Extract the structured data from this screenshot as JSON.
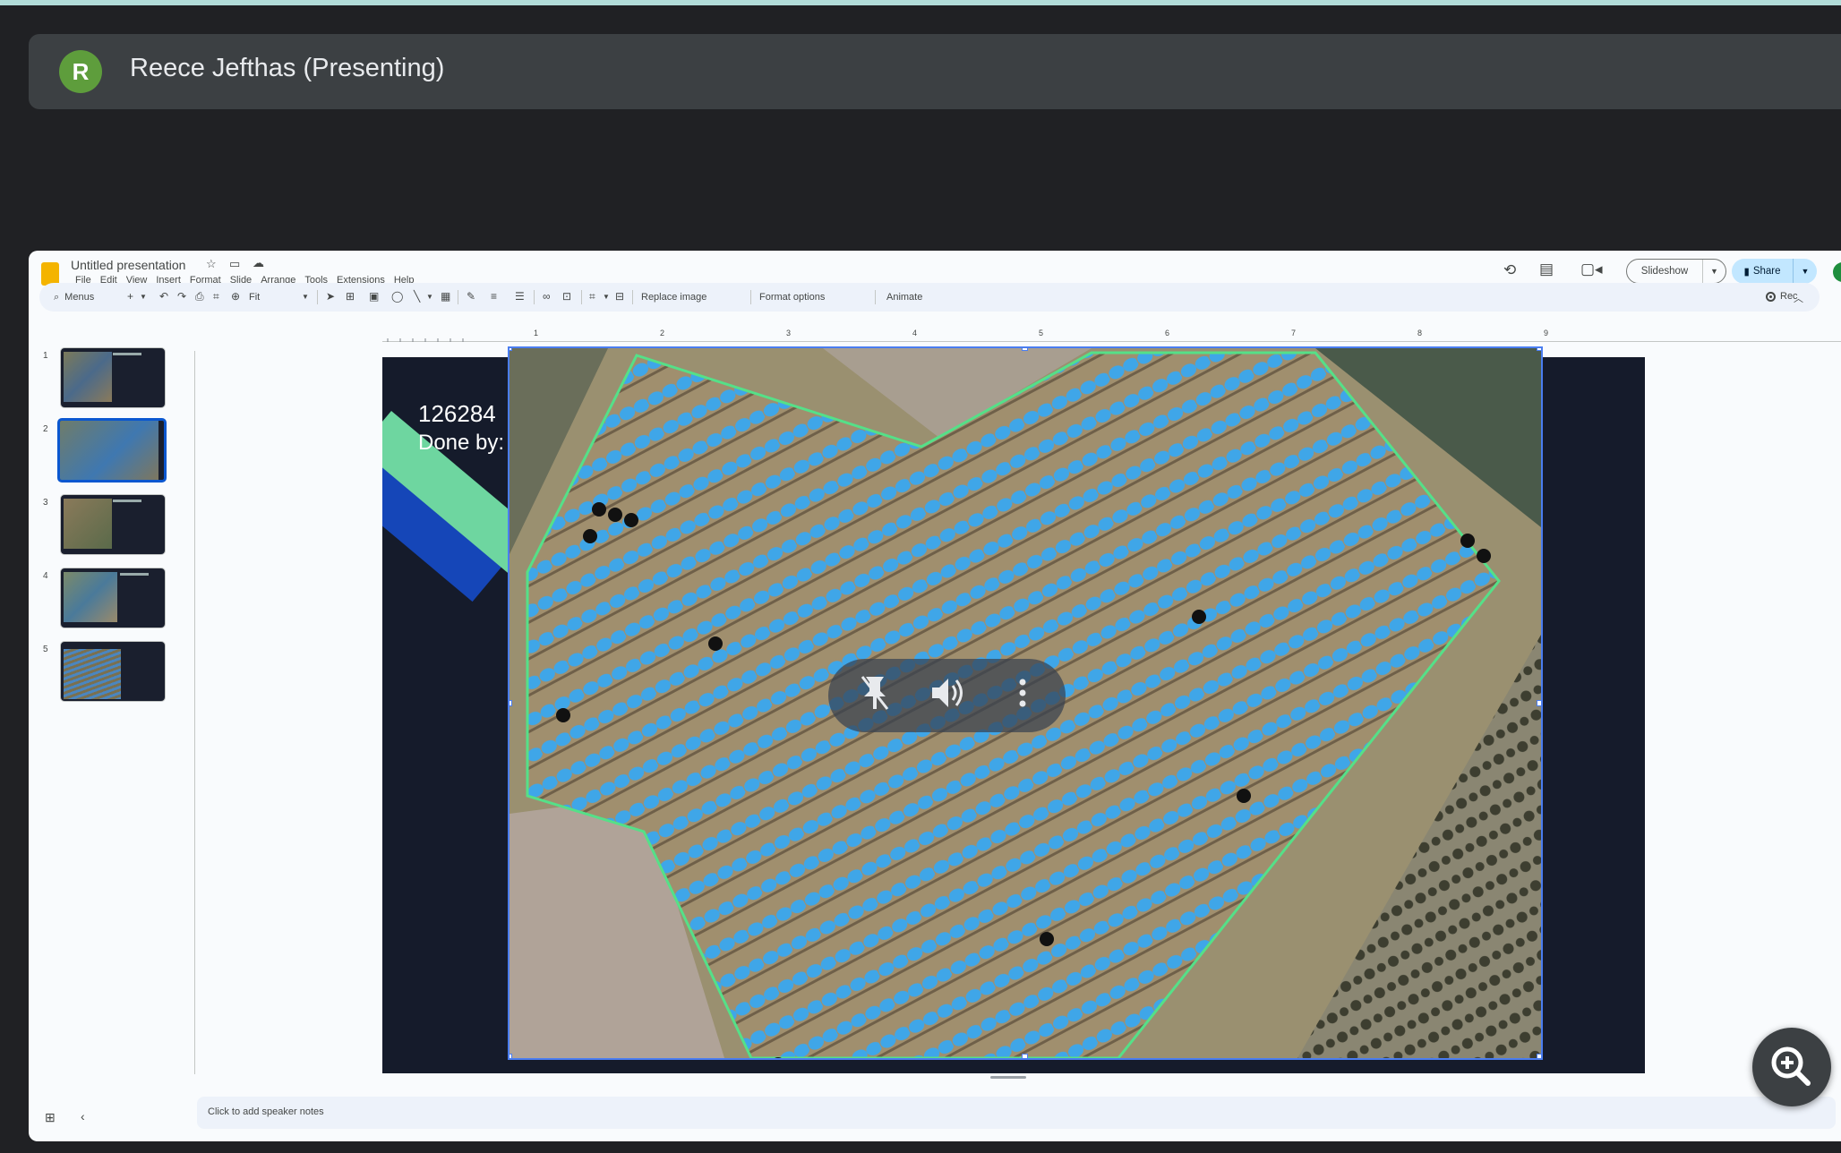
{
  "presenter": {
    "initial": "R",
    "name": "Reece Jefthas (Presenting)"
  },
  "doc": {
    "title": "Untitled presentation",
    "menus": [
      "File",
      "Edit",
      "View",
      "Insert",
      "Format",
      "Slide",
      "Arrange",
      "Tools",
      "Extensions",
      "Help"
    ],
    "slideshow_label": "Slideshow",
    "share_label": "Share"
  },
  "toolbar": {
    "search_label": "Menus",
    "zoom_label": "Fit",
    "replace_image": "Replace image",
    "format_options": "Format options",
    "animate": "Animate",
    "rec_label": "Rec"
  },
  "filmstrip": {
    "slide_numbers": [
      "1",
      "2",
      "3",
      "4",
      "5"
    ],
    "selected": "2"
  },
  "slide": {
    "number_text": "126284",
    "done_by_text": "Done by:"
  },
  "ruler_labels": [
    "1",
    "2",
    "3",
    "4",
    "5",
    "6",
    "7",
    "8",
    "9"
  ],
  "notes": {
    "placeholder": "Click to add speaker notes"
  },
  "colors": {
    "accent": "#0b57d0",
    "share_bg": "#c2e7ff",
    "detection_blue": "#3fa6e8",
    "boundary_green": "#55e088"
  }
}
